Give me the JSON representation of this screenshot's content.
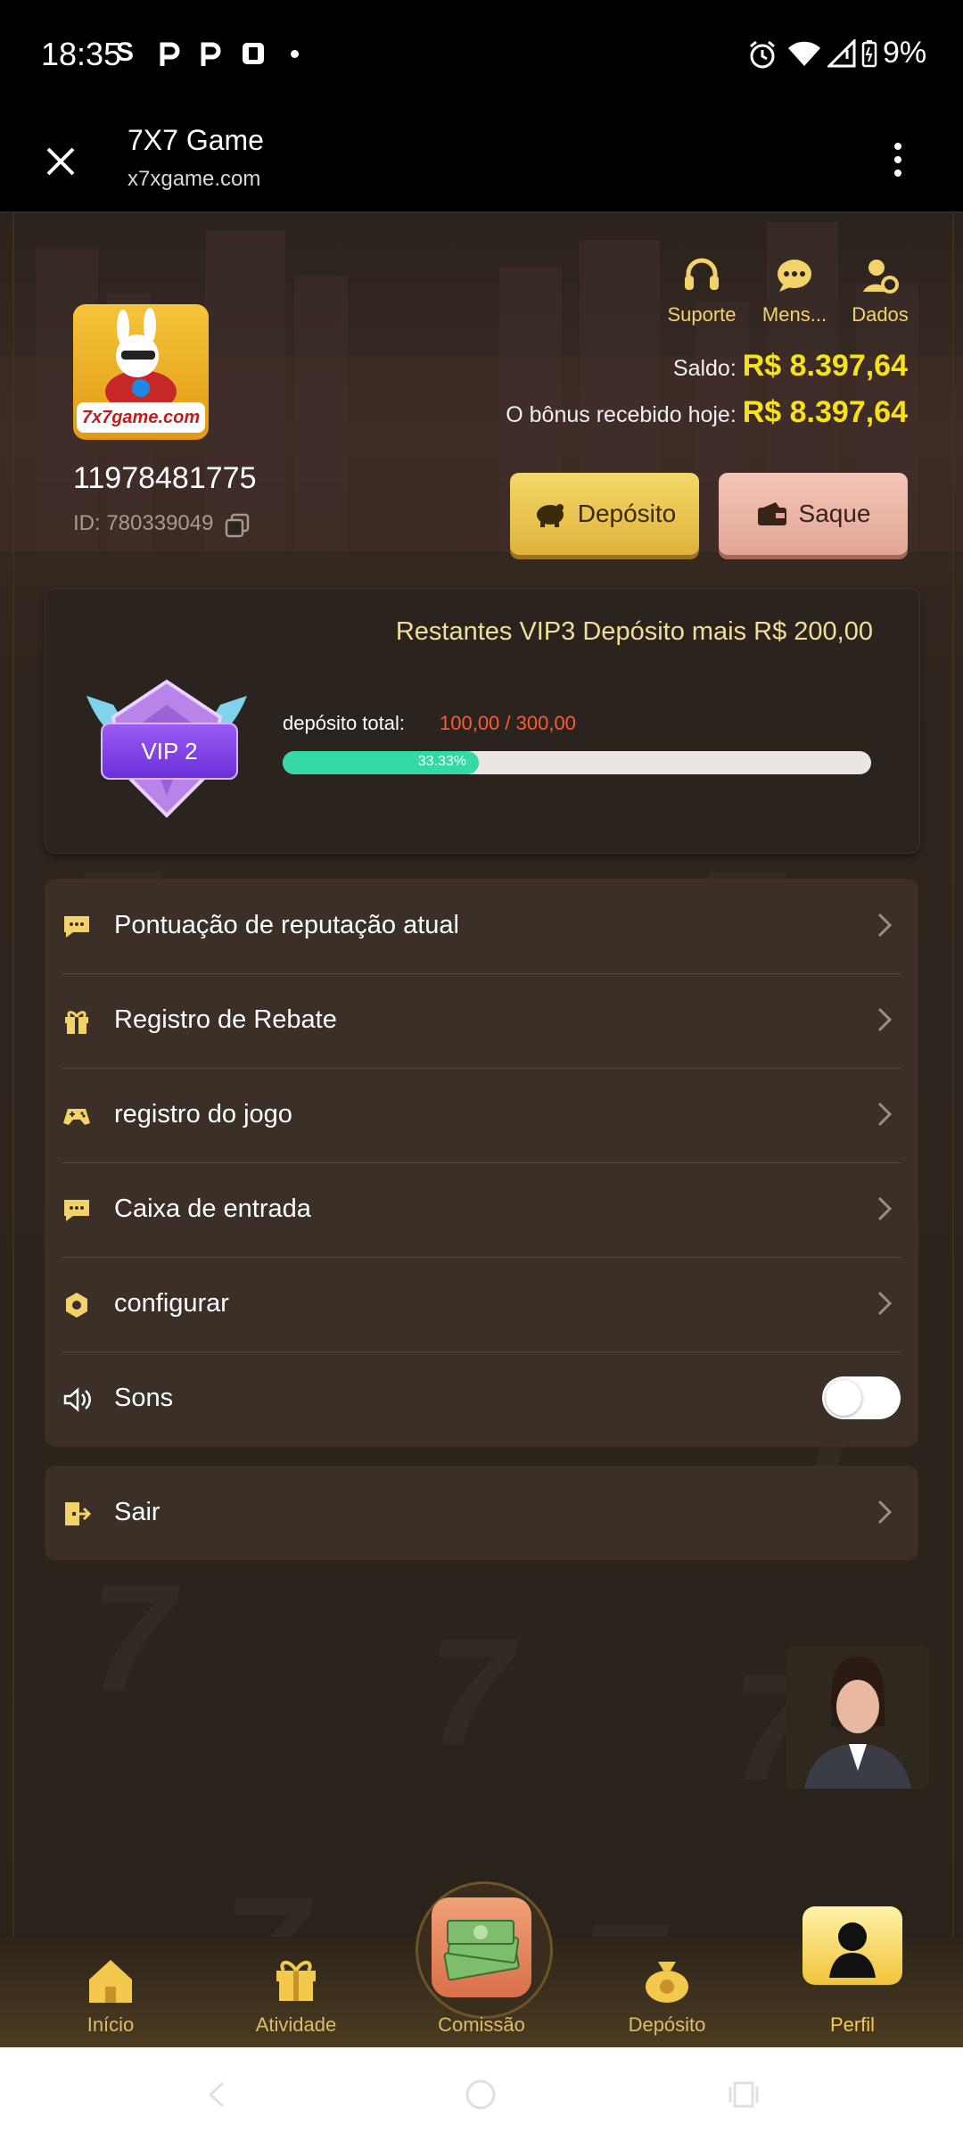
{
  "status_bar": {
    "time": "18:35",
    "battery": "9%"
  },
  "browser": {
    "title": "7X7 Game",
    "url": "x7xgame.com"
  },
  "profile": {
    "logo_text": "7x7game.com",
    "phone": "11978481775",
    "id_text": "ID: 780339049"
  },
  "top_actions": [
    {
      "label": "Suporte",
      "icon": "headset-icon"
    },
    {
      "label": "Mens...",
      "icon": "message-icon"
    },
    {
      "label": "Dados",
      "icon": "user-settings-icon"
    }
  ],
  "balance": {
    "saldo_label": "Saldo:",
    "saldo_value": "R$ 8.397,64",
    "bonus_label": "O bônus recebido hoje:",
    "bonus_value": "R$ 8.397,64"
  },
  "buttons": {
    "deposit": "Depósito",
    "withdraw": "Saque"
  },
  "vip": {
    "headline": "Restantes VIP3 Depósito mais R$ 200,00",
    "badge": "VIP 2",
    "deposit_label": "depósito total:",
    "deposit_value": "100,00 / 300,00",
    "progress_text": "33.33%",
    "progress": 0.3333
  },
  "menu": [
    {
      "label": "Pontuação de reputação atual",
      "icon": "chat-icon"
    },
    {
      "label": "Registro de Rebate",
      "icon": "gift-icon"
    },
    {
      "label": "registro do jogo",
      "icon": "gamepad-icon"
    },
    {
      "label": "Caixa de entrada",
      "icon": "inbox-icon"
    },
    {
      "label": "configurar",
      "icon": "gear-icon"
    },
    {
      "label": "Sons",
      "icon": "speaker-icon",
      "toggle": false
    }
  ],
  "logout": {
    "label": "Sair",
    "icon": "logout-icon"
  },
  "bottom_nav": [
    {
      "label": "Início",
      "icon": "home-icon"
    },
    {
      "label": "Atividade",
      "icon": "gift-icon"
    },
    {
      "label": "Comissão",
      "icon": "money-stack-icon"
    },
    {
      "label": "Depósito",
      "icon": "coin-bag-icon"
    },
    {
      "label": "Perfil",
      "icon": "user-icon",
      "active": true
    }
  ],
  "colors": {
    "accent_gold": "#f0cf58",
    "balance_yellow": "#f5e21a",
    "progress_green": "#34d9a5",
    "deposit_red": "#ff5a36"
  }
}
